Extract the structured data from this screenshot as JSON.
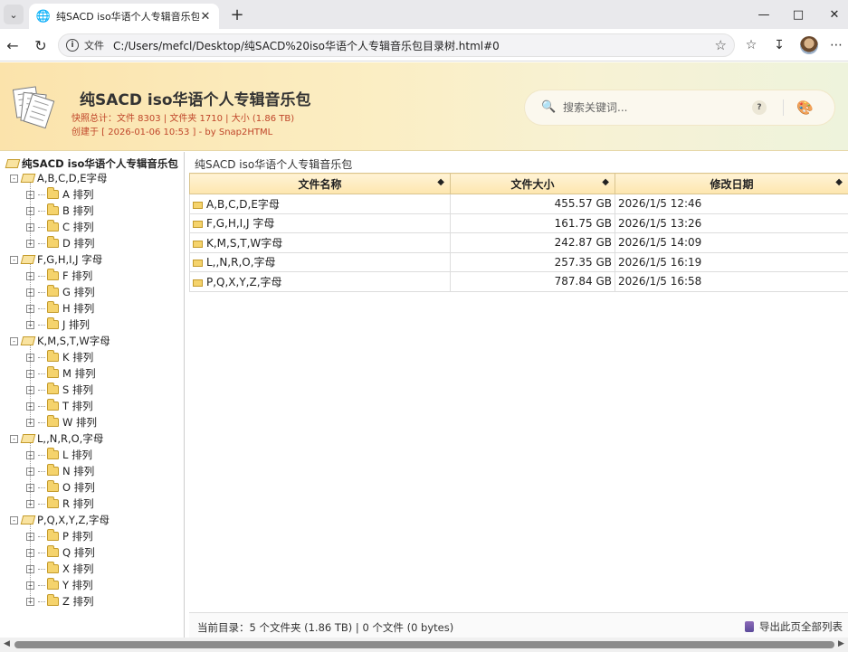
{
  "browser": {
    "tab_title": "纯SACD iso华语个人专辑音乐包",
    "file_chip": "文件",
    "url": "C:/Users/mefcl/Desktop/纯SACD%20iso华语个人专辑音乐包目录树.html#0"
  },
  "header": {
    "title": "纯SACD iso华语个人专辑音乐包",
    "stats_line": "快照总计：文件 8303 | 文件夹 1710 | 大小 (1.86 TB)",
    "created_line": "创建于 [ 2026-01-06 10:53 ] - by Snap2HTML",
    "search_placeholder": "搜索关键词...",
    "help_label": "?"
  },
  "tree": {
    "root": "纯SACD iso华语个人专辑音乐包",
    "groups": [
      {
        "label": "A,B,C,D,E字母",
        "children": [
          "A 排列",
          "B 排列",
          "C 排列",
          "D 排列"
        ]
      },
      {
        "label": "F,G,H,I,J 字母",
        "children": [
          "F 排列",
          "G 排列",
          "H 排列",
          "J 排列"
        ]
      },
      {
        "label": "K,M,S,T,W字母",
        "children": [
          "K 排列",
          "M 排列",
          "S 排列",
          "T 排列",
          "W 排列"
        ]
      },
      {
        "label": "L,,N,R,O,字母",
        "children": [
          "L 排列",
          "N 排列",
          "O 排列",
          "R 排列"
        ]
      },
      {
        "label": "P,Q,X,Y,Z,字母",
        "children": [
          "P 排列",
          "Q 排列",
          "X 排列",
          "Y 排列",
          "Z 排列"
        ]
      }
    ]
  },
  "main": {
    "breadcrumb": "纯SACD iso华语个人专辑音乐包",
    "columns": [
      "文件名称",
      "文件大小",
      "修改日期"
    ],
    "rows": [
      {
        "name": "A,B,C,D,E字母",
        "size": "455.57 GB",
        "date": "2026/1/5 12:46"
      },
      {
        "name": "F,G,H,I,J 字母",
        "size": "161.75 GB",
        "date": "2026/1/5 13:26"
      },
      {
        "name": "K,M,S,T,W字母",
        "size": "242.87 GB",
        "date": "2026/1/5 14:09"
      },
      {
        "name": "L,,N,R,O,字母",
        "size": "257.35 GB",
        "date": "2026/1/5 16:19"
      },
      {
        "name": "P,Q,X,Y,Z,字母",
        "size": "787.84 GB",
        "date": "2026/1/5 16:58"
      }
    ],
    "status": "当前目录：5 个文件夹 (1.86 TB) | 0 个文件 (0 bytes)",
    "export_label": "导出此页全部列表"
  }
}
